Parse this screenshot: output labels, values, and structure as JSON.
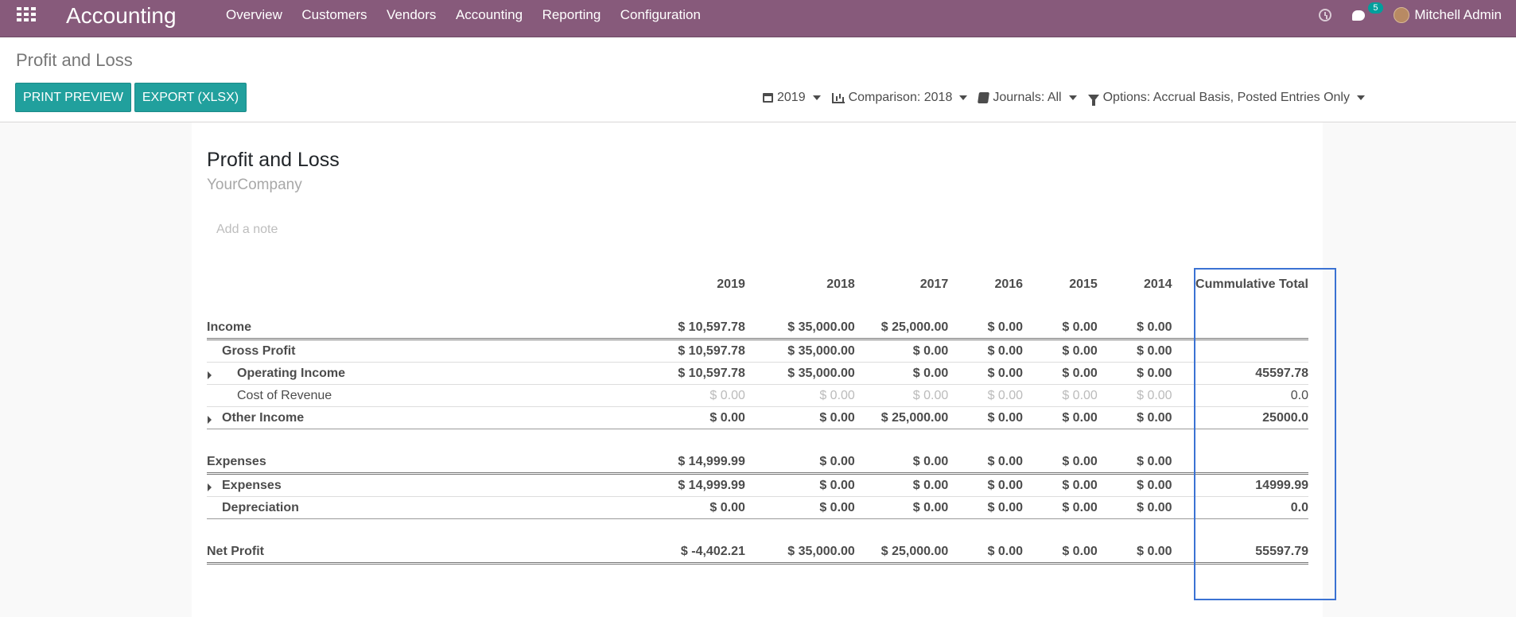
{
  "navbar": {
    "app_name": "Accounting",
    "menu": [
      "Overview",
      "Customers",
      "Vendors",
      "Accounting",
      "Reporting",
      "Configuration"
    ],
    "chat_badge": "5",
    "user_name": "Mitchell Admin",
    "icons": [
      "apps-grid-icon",
      "clock-icon",
      "chat-icon"
    ]
  },
  "control_panel": {
    "breadcrumb": "Profit and Loss",
    "buttons": {
      "print": "PRINT PREVIEW",
      "export": "EXPORT (XLSX)"
    },
    "filters": {
      "period": "2019",
      "comparison": "Comparison: 2018",
      "journals": "Journals: All",
      "options": "Options: Accrual Basis, Posted Entries Only"
    }
  },
  "report": {
    "title": "Profit and Loss",
    "company": "YourCompany",
    "note_placeholder": "Add a note",
    "columns": [
      "2019",
      "2018",
      "2017",
      "2016",
      "2015",
      "2014",
      "Cummulative Total"
    ],
    "rows": {
      "income": {
        "label": "Income",
        "values": [
          "$ 10,597.78",
          "$ 35,000.00",
          "$ 25,000.00",
          "$ 0.00",
          "$ 0.00",
          "$ 0.00"
        ],
        "total": ""
      },
      "gross_profit": {
        "label": "Gross Profit",
        "values": [
          "$ 10,597.78",
          "$ 35,000.00",
          "$ 0.00",
          "$ 0.00",
          "$ 0.00",
          "$ 0.00"
        ],
        "total": ""
      },
      "operating_income": {
        "label": "Operating Income",
        "values": [
          "$ 10,597.78",
          "$ 35,000.00",
          "$ 0.00",
          "$ 0.00",
          "$ 0.00",
          "$ 0.00"
        ],
        "total": "45597.78"
      },
      "cost_of_revenue": {
        "label": "Cost of Revenue",
        "values": [
          "$ 0.00",
          "$ 0.00",
          "$ 0.00",
          "$ 0.00",
          "$ 0.00",
          "$ 0.00"
        ],
        "total": "0.0"
      },
      "other_income": {
        "label": "Other Income",
        "values": [
          "$ 0.00",
          "$ 0.00",
          "$ 25,000.00",
          "$ 0.00",
          "$ 0.00",
          "$ 0.00"
        ],
        "total": "25000.0"
      },
      "expenses_section": {
        "label": "Expenses",
        "values": [
          "$ 14,999.99",
          "$ 0.00",
          "$ 0.00",
          "$ 0.00",
          "$ 0.00",
          "$ 0.00"
        ],
        "total": ""
      },
      "expenses": {
        "label": "Expenses",
        "values": [
          "$ 14,999.99",
          "$ 0.00",
          "$ 0.00",
          "$ 0.00",
          "$ 0.00",
          "$ 0.00"
        ],
        "total": "14999.99"
      },
      "depreciation": {
        "label": "Depreciation",
        "values": [
          "$ 0.00",
          "$ 0.00",
          "$ 0.00",
          "$ 0.00",
          "$ 0.00",
          "$ 0.00"
        ],
        "total": "0.0"
      },
      "net_profit": {
        "label": "Net Profit",
        "values": [
          "$ -4,402.21",
          "$ 35,000.00",
          "$ 25,000.00",
          "$ 0.00",
          "$ 0.00",
          "$ 0.00"
        ],
        "total": "55597.79"
      }
    }
  },
  "colors": {
    "navbar": "#875a7b",
    "primary_button": "#21a09d",
    "highlight_box": "#3b72d3",
    "badge": "#00a09d"
  }
}
